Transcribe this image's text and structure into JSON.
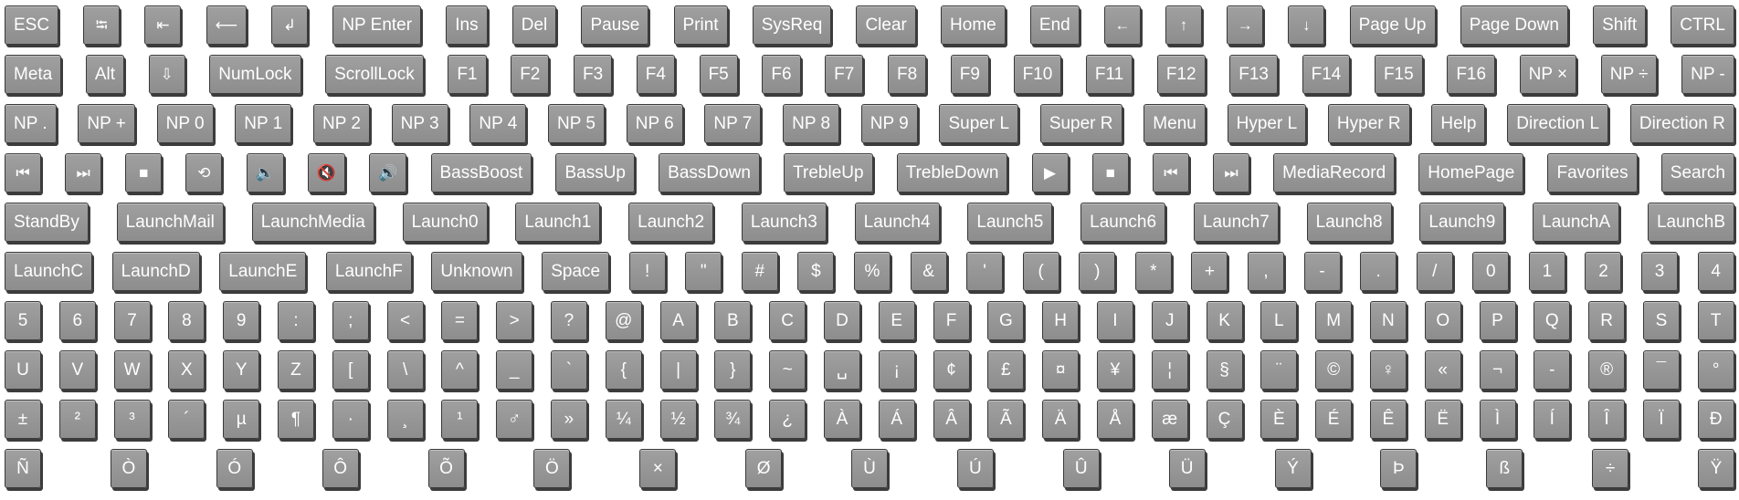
{
  "rows": [
    [
      "ESC",
      "⭾",
      "⇤",
      "⟵",
      "↲",
      "NP Enter",
      "Ins",
      "Del",
      "Pause",
      "Print",
      "SysReq",
      "Clear",
      "Home",
      "End",
      "←",
      "↑",
      "→",
      "↓",
      "Page Up",
      "Page Down",
      "Shift",
      "CTRL"
    ],
    [
      "Meta",
      "Alt",
      "⇩",
      "NumLock",
      "ScrollLock",
      "F1",
      "F2",
      "F3",
      "F4",
      "F5",
      "F6",
      "F7",
      "F8",
      "F9",
      "F10",
      "F11",
      "F12",
      "F13",
      "F14",
      "F15",
      "F16",
      "NP ×",
      "NP ÷",
      "NP -"
    ],
    [
      "NP .",
      "NP +",
      "NP 0",
      "NP 1",
      "NP 2",
      "NP 3",
      "NP 4",
      "NP 5",
      "NP 6",
      "NP 7",
      "NP 8",
      "NP 9",
      "Super L",
      "Super R",
      "Menu",
      "Hyper L",
      "Hyper R",
      "Help",
      "Direction L",
      "Direction R"
    ],
    [
      "⏮",
      "⏭",
      "■",
      "⟲",
      "🔈",
      "🔇",
      "🔊",
      "BassBoost",
      "BassUp",
      "BassDown",
      "TrebleUp",
      "TrebleDown",
      "▶",
      "■",
      "⏮",
      "⏭",
      "MediaRecord",
      "HomePage",
      "Favorites",
      "Search"
    ],
    [
      "StandBy",
      "LaunchMail",
      "LaunchMedia",
      "Launch0",
      "Launch1",
      "Launch2",
      "Launch3",
      "Launch4",
      "Launch5",
      "Launch6",
      "Launch7",
      "Launch8",
      "Launch9",
      "LaunchA",
      "LaunchB"
    ],
    [
      "LaunchC",
      "LaunchD",
      "LaunchE",
      "LaunchF",
      "Unknown",
      "Space",
      "!",
      "\"",
      "#",
      "$",
      "%",
      "&",
      "'",
      "(",
      ")",
      "*",
      "+",
      ",",
      "-",
      ".",
      "/",
      "0",
      "1",
      "2",
      "3",
      "4"
    ],
    [
      "5",
      "6",
      "7",
      "8",
      "9",
      ":",
      ";",
      "<",
      "=",
      ">",
      "?",
      "@",
      "A",
      "B",
      "C",
      "D",
      "E",
      "F",
      "G",
      "H",
      "I",
      "J",
      "K",
      "L",
      "M",
      "N",
      "O",
      "P",
      "Q",
      "R",
      "S",
      "T"
    ],
    [
      "U",
      "V",
      "W",
      "X",
      "Y",
      "Z",
      "[",
      "\\",
      "^",
      "_",
      "`",
      "{",
      "|",
      "}",
      "~",
      "␣",
      "¡",
      "¢",
      "£",
      "¤",
      "¥",
      "¦",
      "§",
      "¨",
      "©",
      "♀",
      "«",
      "¬",
      "-",
      "®",
      "¯",
      "°"
    ],
    [
      "±",
      "²",
      "³",
      "´",
      "µ",
      "¶",
      "·",
      "¸",
      "¹",
      "♂",
      "»",
      "¼",
      "½",
      "¾",
      "¿",
      "À",
      "Á",
      "Â",
      "Ã",
      "Ä",
      "Å",
      "æ",
      "Ç",
      "È",
      "É",
      "Ê",
      "Ë",
      "Ì",
      "Í",
      "Î",
      "Ï",
      "Ð"
    ],
    [
      "Ñ",
      "Ò",
      "Ó",
      "Ô",
      "Õ",
      "Ö",
      "×",
      "Ø",
      "Ù",
      "Ú",
      "Û",
      "Ü",
      "Ý",
      "Þ",
      "ß",
      "÷",
      "Ÿ"
    ]
  ],
  "icons": {
    "⭾": "tab-icon",
    "⇤": "backtab-icon",
    "⟵": "backspace-icon",
    "↲": "return-icon",
    "←": "left-arrow-icon",
    "↑": "up-arrow-icon",
    "→": "right-arrow-icon",
    "↓": "down-arrow-icon",
    "⇩": "caps-lock-icon",
    "⏮": "previous-track-icon",
    "⏭": "next-track-icon",
    "■": "stop-icon",
    "⟲": "refresh-icon",
    "🔈": "volume-down-icon",
    "🔇": "mute-icon",
    "🔊": "volume-up-icon",
    "▶": "play-icon"
  },
  "colors": {
    "key_face": "#999999",
    "key_border": "#3a3a3a",
    "key_text": "#ffffff",
    "background": "#ffffff"
  }
}
